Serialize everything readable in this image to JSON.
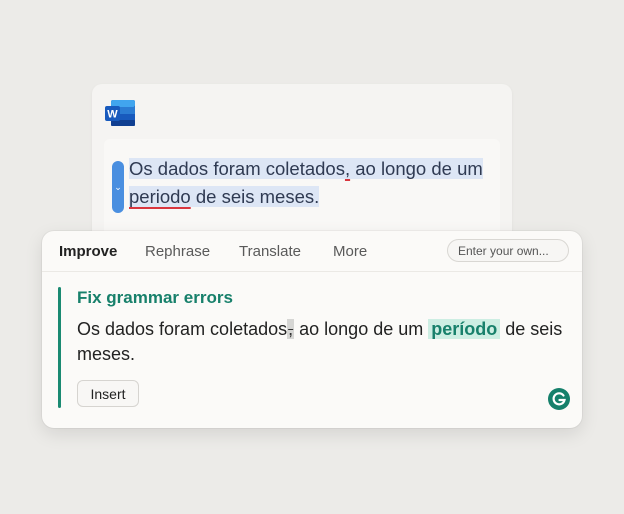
{
  "document": {
    "paragraph": {
      "part1": "Os dados foram coletados",
      "comma": ",",
      "part2": " ao longo de um ",
      "flagged_word": "periodo",
      "part3": " de seis meses."
    }
  },
  "assistant": {
    "tabs": [
      "Improve",
      "Rephrase",
      "Translate",
      "More"
    ],
    "custom_prompt_placeholder": "Enter your own...",
    "suggestion": {
      "title": "Fix grammar errors",
      "part1": "Os dados foram coletados",
      "removed": ",",
      "part2": " ao longo de um ",
      "inserted": "período",
      "part3": " de seis meses."
    },
    "insert_label": "Insert"
  },
  "colors": {
    "accent_green": "#17806b",
    "word_blue": "#2b5fb8",
    "highlight_blue": "#dde6f5",
    "error_red": "#d9363e"
  },
  "icons": {
    "doc_app": "microsoft-word-icon",
    "caret": "chevron-down-icon",
    "brand": "grammarly-icon"
  }
}
